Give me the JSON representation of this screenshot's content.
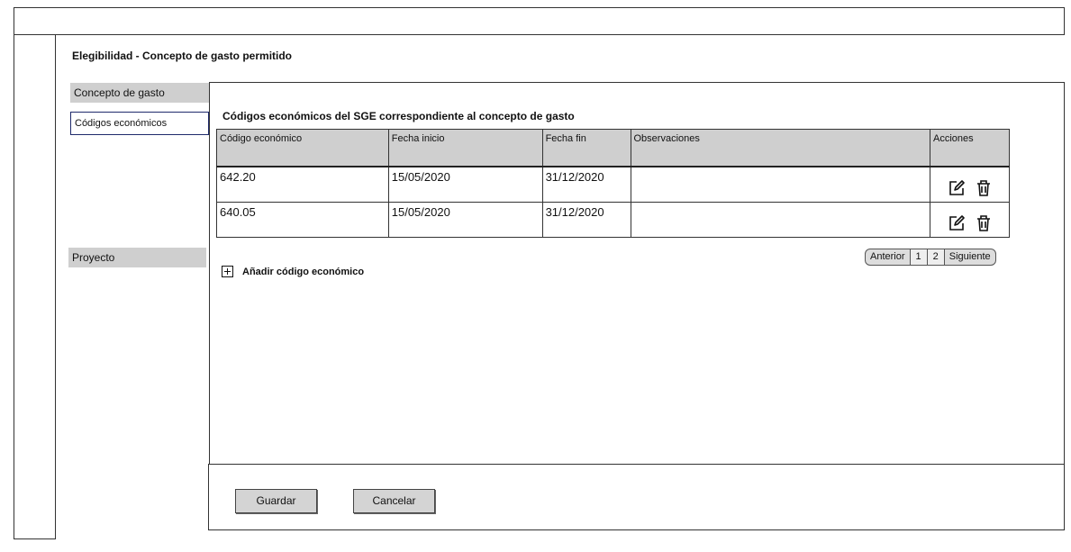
{
  "page": {
    "title": "Elegibilidad - Concepto de gasto permitido"
  },
  "sidebar": {
    "sections": [
      {
        "label": "Concepto de gasto",
        "items": [
          {
            "label": "Códigos económicos",
            "selected": true
          }
        ]
      },
      {
        "label": "Proyecto",
        "items": []
      }
    ]
  },
  "main": {
    "section_title": "Códigos económicos del SGE correspondiente al concepto de gasto",
    "table": {
      "columns": [
        "Código económico",
        "Fecha inicio",
        "Fecha fin",
        "Observaciones",
        "Acciones"
      ],
      "rows": [
        {
          "codigo": "642.20",
          "inicio": "15/05/2020",
          "fin": "31/12/2020",
          "observaciones": ""
        },
        {
          "codigo": "640.05",
          "inicio": "15/05/2020",
          "fin": "31/12/2020",
          "observaciones": ""
        }
      ]
    },
    "pagination": {
      "previous": "Anterior",
      "pages": [
        "1",
        "2"
      ],
      "next": "Siguiente"
    },
    "add_label": "Añadir código económico"
  },
  "footer": {
    "save": "Guardar",
    "cancel": "Cancelar"
  },
  "icons": {
    "edit": "edit-icon",
    "delete": "trash-icon",
    "add": "plus-box-icon"
  },
  "colors": {
    "header_bg": "#cfcfcf",
    "selected_border": "#1f2a6b",
    "button_bg": "#d4d4d4"
  }
}
